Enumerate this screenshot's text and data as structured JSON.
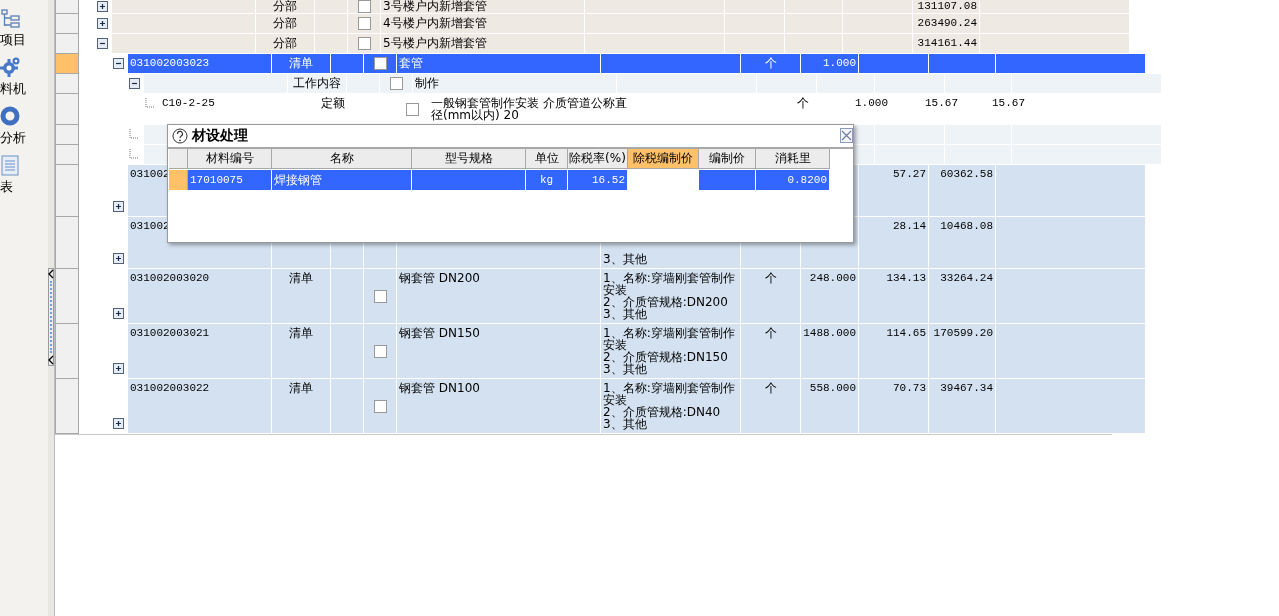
{
  "sidebar": {
    "items": [
      {
        "kind": "tree",
        "label": "项目"
      },
      {
        "kind": "gear",
        "label": "料机"
      },
      {
        "kind": "ring",
        "label": "分析"
      },
      {
        "kind": "report",
        "label": "表"
      }
    ]
  },
  "splitter": {
    "collapsed": false
  },
  "grid": {
    "rows": [
      {
        "kind": "fenbu",
        "selected": false,
        "expanded": false,
        "type": "分部",
        "checked": false,
        "name": "3号楼户内新增套管",
        "total": "131107.08"
      },
      {
        "kind": "fenbu",
        "selected": false,
        "expanded": false,
        "type": "分部",
        "checked": false,
        "name": "4号楼户内新增套管",
        "total": "263490.24"
      },
      {
        "kind": "fenbu",
        "selected": false,
        "expanded": true,
        "type": "分部",
        "checked": false,
        "name": "5号楼户内新增套管",
        "total": "314161.44",
        "children": [
          {
            "kind": "qingdan",
            "selected": true,
            "expanded": true,
            "code": "031002003023",
            "type": "清单",
            "checked": false,
            "name": "套管",
            "unit": "个",
            "quantity": "1.000",
            "children": [
              {
                "kind": "content",
                "selected": false,
                "expanded": true,
                "type": "工作内容",
                "checked": false,
                "name": "制作",
                "children": [
                  {
                    "kind": "quota",
                    "selected": false,
                    "code": "C10-2-25",
                    "type": "定额",
                    "checked": false,
                    "name": "一般钢套管制作安装 介质管道公称直径(mm以内) 20",
                    "unit": "个",
                    "quantity": "1.000",
                    "price": "15.67",
                    "total": "15.67"
                  }
                ]
              },
              {
                "kind": "content",
                "selected": false
              },
              {
                "kind": "content",
                "selected": false
              }
            ]
          },
          {
            "kind": "qingdan",
            "selected": false,
            "expanded": false,
            "code": "031002",
            "price": "57.27",
            "total": "60362.58"
          },
          {
            "kind": "qingdan",
            "selected": false,
            "expanded": false,
            "code": "031002",
            "features": "3、其他",
            "price": "28.14",
            "total": "10468.08"
          },
          {
            "kind": "qingdan",
            "selected": false,
            "expanded": false,
            "code": "031002003020",
            "type": "清单",
            "checked": false,
            "name": "钢套管 DN200",
            "features": "1、名称:穿墙刚套管制作安装\n2、介质管规格:DN200\n3、其他",
            "unit": "个",
            "quantity": "248.000",
            "price": "134.13",
            "total": "33264.24"
          },
          {
            "kind": "qingdan",
            "selected": false,
            "expanded": false,
            "code": "031002003021",
            "type": "清单",
            "checked": false,
            "name": "钢套管 DN150",
            "features": "1、名称:穿墙刚套管制作安装\n2、介质管规格:DN150\n3、其他",
            "unit": "个",
            "quantity": "1488.000",
            "price": "114.65",
            "total": "170599.20"
          },
          {
            "kind": "qingdan",
            "selected": false,
            "expanded": false,
            "code": "031002003022",
            "type": "清单",
            "checked": false,
            "name": "钢套管 DN100",
            "features": "1、名称:穿墙刚套管制作安装\n2、介质管规格:DN40\n3、其他",
            "unit": "个",
            "quantity": "558.000",
            "price": "70.73",
            "total": "39467.34"
          }
        ]
      }
    ]
  },
  "dialog": {
    "title": "材设处理",
    "columns": [
      {
        "label": "材料编号",
        "selected": false
      },
      {
        "label": "名称",
        "selected": false
      },
      {
        "label": "型号规格",
        "selected": false
      },
      {
        "label": "单位",
        "selected": false
      },
      {
        "label": "除税率(%)",
        "selected": false
      },
      {
        "label": "除税编制价",
        "selected": true
      },
      {
        "label": "编制价",
        "selected": false
      },
      {
        "label": "消耗里",
        "selected": false
      }
    ],
    "rows": [
      {
        "selected": true,
        "code": "17010075",
        "name": "焊接钢管",
        "unit": "kg",
        "tax_rate": "16.52",
        "consumption": "0.8200"
      }
    ]
  }
}
